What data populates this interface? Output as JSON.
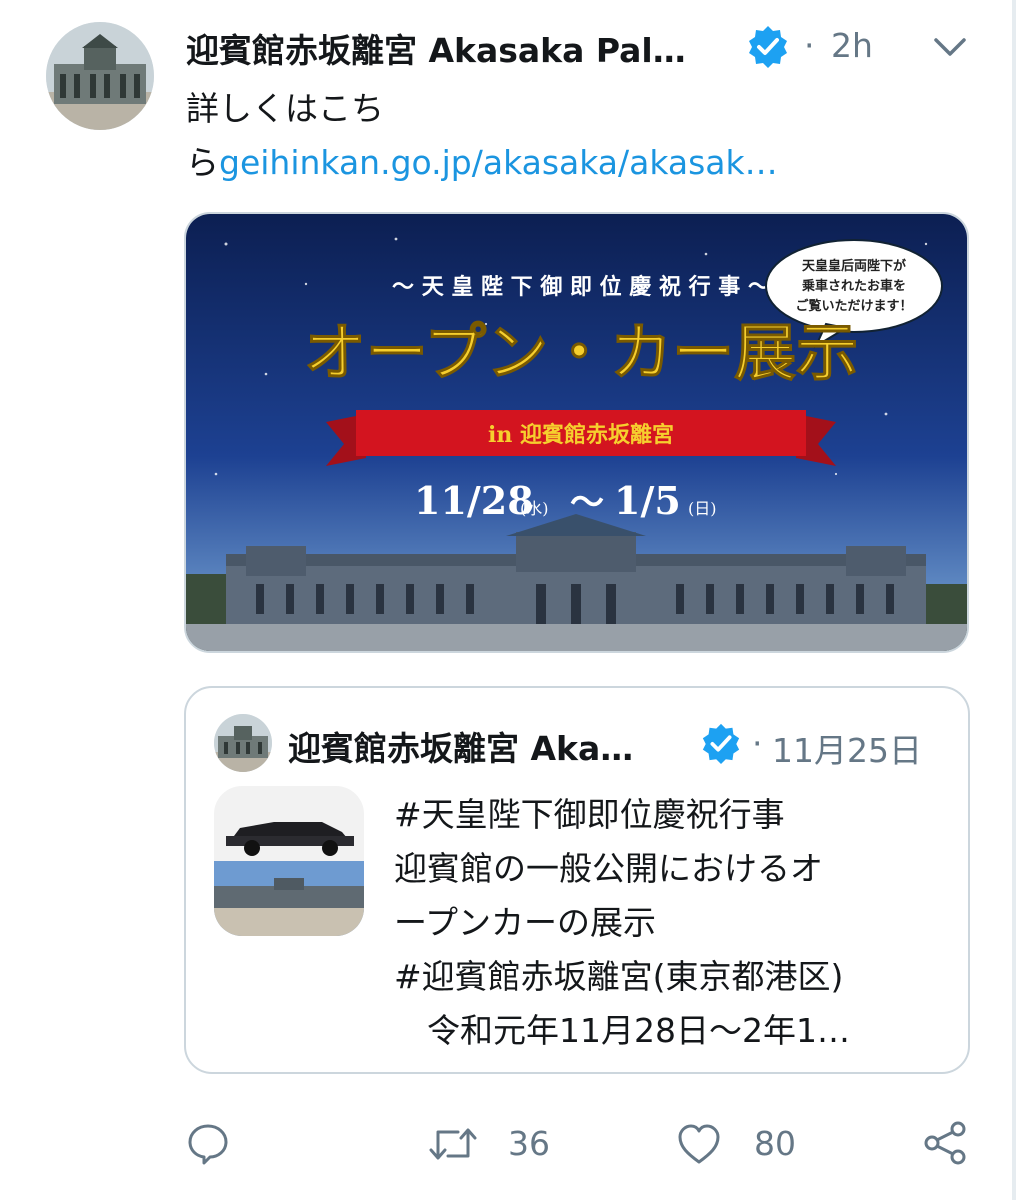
{
  "tweet": {
    "author": "迎賓館赤坂離宮 Akasaka Pal…",
    "time": "2h",
    "separator": "·",
    "text_line1": "詳しくはこち",
    "text_line2_prefix": "ら",
    "link_text": "geihinkan.go.jp/akasaka/akasak…"
  },
  "media": {
    "subtitle": "〜 天 皇 陛 下 御 即 位 慶 祝 行 事 〜",
    "headline": "オープン・カー展示",
    "ribbon": "in 迎賓館赤坂離宮",
    "bubble_line1": "天皇皇后両陛下が",
    "bubble_line2": "乗車されたお車を",
    "bubble_line3": "ご覧いただけます！",
    "date_start": "11/28",
    "date_start_day": "(水)",
    "date_tilde": "〜",
    "date_end": "1/5",
    "date_end_day": "(日)"
  },
  "quote": {
    "author": "迎賓館赤坂離宮 Aka…",
    "separator": "·",
    "date": "11月25日",
    "lines": [
      "#天皇陛下御即位慶祝行事",
      "迎賓館の一般公開におけるオ",
      "ープンカーの展示",
      "#迎賓館赤坂離宮(東京都港区)",
      "　令和元年11月28日～2年1…"
    ]
  },
  "actions": {
    "retweets": "36",
    "likes": "80"
  },
  "colors": {
    "link": "#1b95e0",
    "verified": "#1da1f2",
    "muted": "#657786",
    "border": "#ccd6dd"
  },
  "icons": [
    "verified-badge-icon",
    "chevron-down-icon",
    "reply-icon",
    "retweet-icon",
    "like-icon",
    "share-icon"
  ]
}
